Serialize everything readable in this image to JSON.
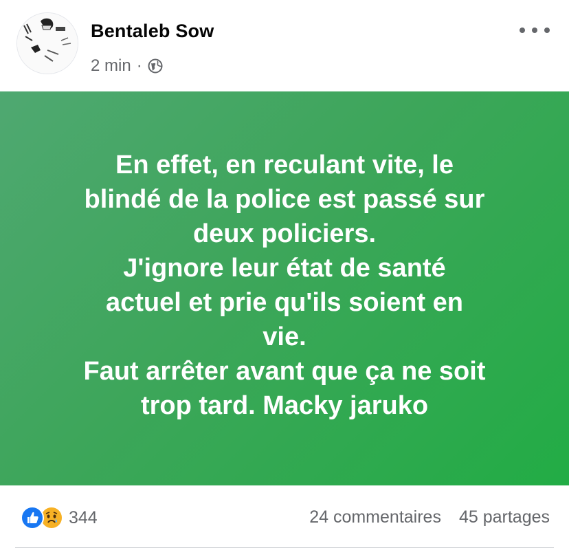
{
  "post": {
    "author": "Bentaleb Sow",
    "time": "2 min",
    "separator": "·",
    "privacy_icon": "globe-icon",
    "more_icon": "more-options-icon",
    "text": "En effet, en reculant vite, le\nblindé de la police est passé sur\ndeux policiers.\nJ'ignore leur état de santé\nactuel et prie qu'ils soient en\nvie.\nFaut arrêter avant que ça ne soit\ntrop tard. Macky jaruko",
    "background_colors": [
      "#4fa871",
      "#22ac45"
    ]
  },
  "footer": {
    "reaction_icons": [
      "like-icon",
      "sad-icon"
    ],
    "reaction_count": "344",
    "comments": "24 commentaires",
    "shares": "45 partages"
  }
}
